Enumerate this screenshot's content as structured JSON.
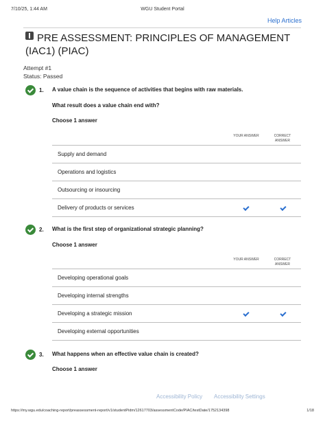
{
  "print_header": {
    "datetime": "7/10/25, 1:44 AM",
    "site": "WGU Student Portal"
  },
  "help_link": "Help Articles",
  "title": "PRE ASSESSMENT: PRINCIPLES OF MANAGEMENT (IAC1) (PIAC)",
  "attempt": {
    "label": "Attempt #1",
    "status": "Status: Passed"
  },
  "columns": {
    "your_answer": "YOUR ANSWER",
    "correct_answer": "CORRECT ANSWER"
  },
  "questions": [
    {
      "number": "1.",
      "lines": [
        "A value chain is the sequence of activities that begins with raw materials.",
        "What result does a value chain end with?"
      ],
      "choose": "Choose 1 answer",
      "options": [
        {
          "text": "Supply and demand",
          "yours": false,
          "correct": false
        },
        {
          "text": "Operations and logistics",
          "yours": false,
          "correct": false
        },
        {
          "text": "Outsourcing or insourcing",
          "yours": false,
          "correct": false
        },
        {
          "text": "Delivery of products or services",
          "yours": true,
          "correct": true
        }
      ]
    },
    {
      "number": "2.",
      "lines": [
        "What is the first step of organizational strategic planning?"
      ],
      "choose": "Choose 1 answer",
      "options": [
        {
          "text": "Developing operational goals",
          "yours": false,
          "correct": false
        },
        {
          "text": "Developing internal strengths",
          "yours": false,
          "correct": false
        },
        {
          "text": "Developing a strategic mission",
          "yours": true,
          "correct": true
        },
        {
          "text": "Developing external opportunities",
          "yours": false,
          "correct": false
        }
      ]
    },
    {
      "number": "3.",
      "lines": [
        "What happens when an effective value chain is created?"
      ],
      "choose": "Choose 1 answer",
      "options": []
    }
  ],
  "footer": {
    "accessibility_policy": "Accessibility Policy",
    "accessibility_settings": "Accessibility Settings"
  },
  "print_footer": {
    "url": "https://my.wgu.edu/coaching-report/preassessment-report/v1/studentPidm/12617703/assessmentCode/PIAC/testDate/1752134398",
    "page": "1/18"
  },
  "colors": {
    "accent": "#2a6fcf",
    "success": "#3a8a3a"
  }
}
